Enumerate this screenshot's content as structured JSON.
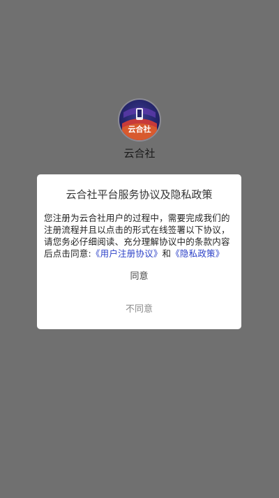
{
  "app": {
    "name": "云合社",
    "icon_label": "云合社",
    "icon": "app-logo-icon"
  },
  "dialog": {
    "title": "云合社平台服务协议及隐私政策",
    "body_text": "您注册为云合社用户的过程中，需要完成我们的注册流程并且以点击的形式在线签署以下协议，请您务必仔细阅读、充分理解协议中的条款内容后点击同意:",
    "link_user_agreement": "《用户注册协议》",
    "conjunction": "和",
    "link_privacy_policy": "《隐私政策》",
    "agree_label": "同意",
    "disagree_label": "不同意"
  },
  "colors": {
    "background": "#707070",
    "link": "#2a3fc7",
    "dialog": "#ffffff"
  }
}
